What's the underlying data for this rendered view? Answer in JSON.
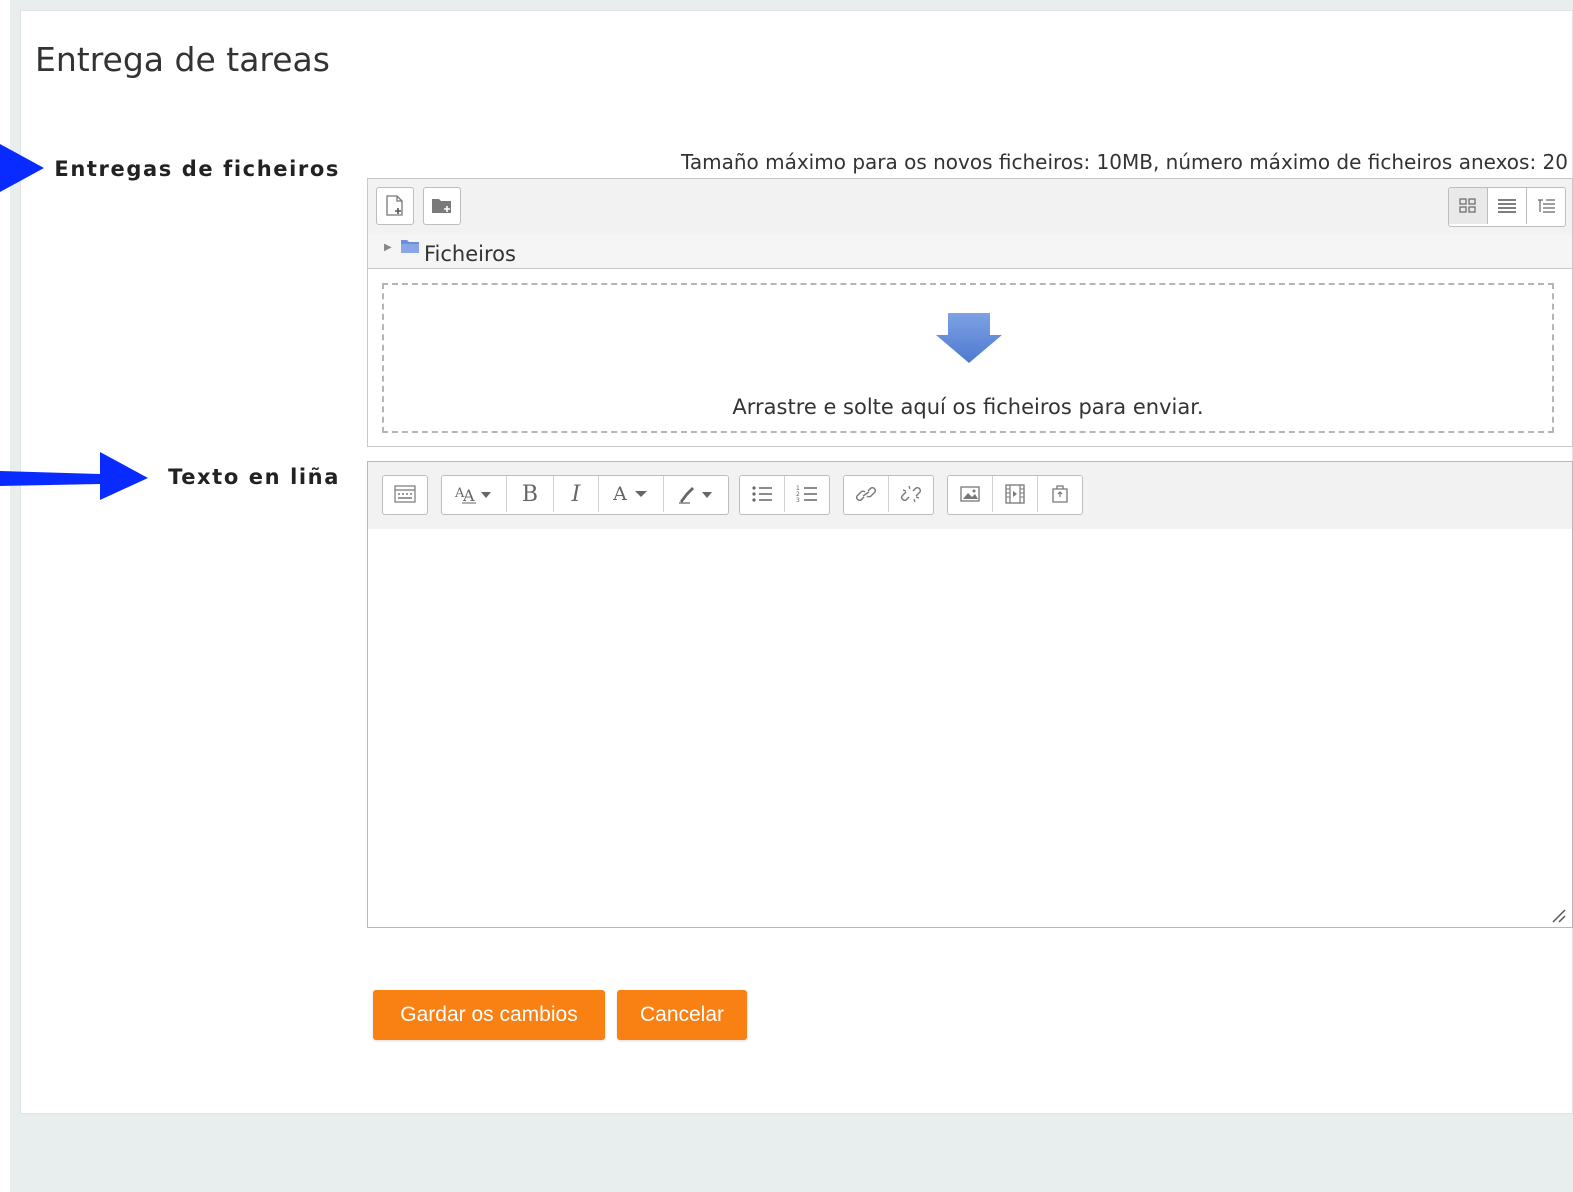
{
  "page": {
    "title": "Entrega de tareas"
  },
  "file_submissions": {
    "label": "Entregas de ficheiros",
    "limits_note": "Tamaño máximo para os novos ficheiros: 10MB, número máximo de ficheiros anexos: 20",
    "toolbar": {
      "buttons": [
        {
          "name": "add-file",
          "icon": "file-add-icon"
        },
        {
          "name": "create-folder",
          "icon": "folder-add-icon"
        }
      ],
      "views": [
        {
          "name": "icons-view",
          "icon": "grid-icon",
          "active": true
        },
        {
          "name": "list-view",
          "icon": "list-icon",
          "active": false
        },
        {
          "name": "tree-view",
          "icon": "tree-icon",
          "active": false
        }
      ]
    },
    "path": {
      "folder_label": "Ficheiros"
    },
    "dropzone": {
      "text": "Arrastre e solte aquí os ficheiros para enviar."
    }
  },
  "online_text": {
    "label": "Texto en liña",
    "toolbar": {
      "groups": [
        [
          "toggle-toolbar-icon"
        ],
        [
          "font-size-icon",
          "bold-icon",
          "italic-icon",
          "font-color-icon",
          "highlight-icon"
        ],
        [
          "unordered-list-icon",
          "ordered-list-icon"
        ],
        [
          "link-icon",
          "unlink-icon"
        ],
        [
          "image-icon",
          "media-icon",
          "manage-files-icon"
        ]
      ],
      "glyphs": {
        "bold": "B",
        "italic": "I",
        "font_color": "A"
      }
    },
    "content": ""
  },
  "actions": {
    "save_label": "Gardar os cambios",
    "cancel_label": "Cancelar"
  },
  "colors": {
    "accent": "#f98012",
    "annotation_arrow": "#0a2bff",
    "folder": "#6f8fd6"
  }
}
